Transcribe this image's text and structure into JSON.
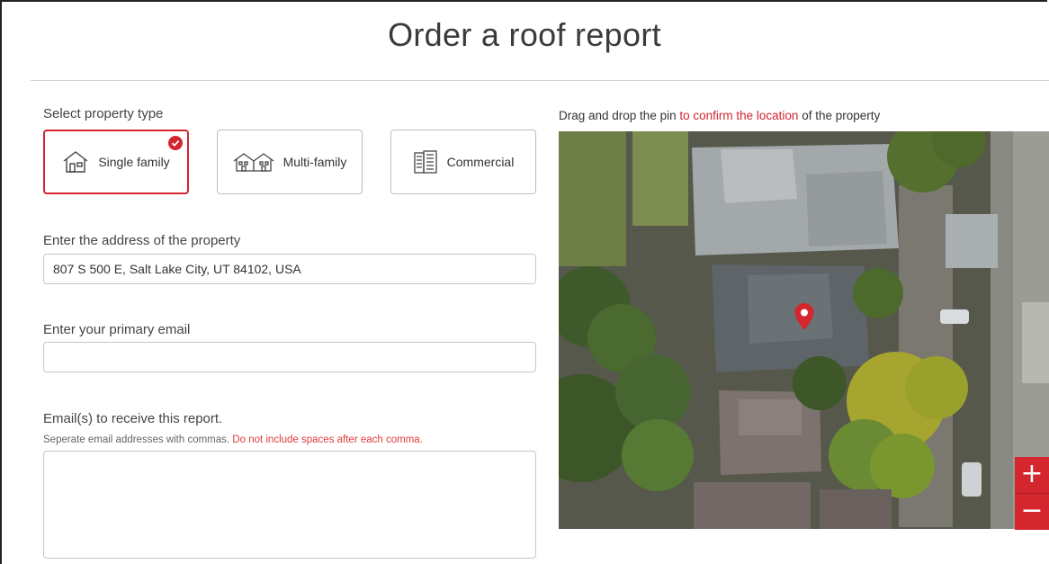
{
  "page": {
    "title": "Order a roof report"
  },
  "property_type": {
    "label": "Select property type",
    "options": [
      {
        "label": "Single family",
        "icon": "single-family-house-icon",
        "selected": true
      },
      {
        "label": "Multi-family",
        "icon": "multi-family-house-icon",
        "selected": false
      },
      {
        "label": "Commercial",
        "icon": "commercial-building-icon",
        "selected": false
      }
    ]
  },
  "address": {
    "label": "Enter the address of the property",
    "value": "807 S 500 E, Salt Lake City, UT 84102, USA"
  },
  "primary_email": {
    "label": "Enter your primary email",
    "value": ""
  },
  "report_emails": {
    "label": "Email(s) to receive this report.",
    "hint": "Seperate email addresses with commas.",
    "hint_warning": "Do not include spaces after each comma.",
    "value": ""
  },
  "map": {
    "label_prefix": "Drag and drop the pin",
    "label_highlight": "to confirm the location",
    "label_suffix": "of the property",
    "zoom_in": "+",
    "zoom_out": "−",
    "pin_icon": "map-pin-icon"
  },
  "colors": {
    "accent": "#d3262e",
    "border": "#c6c6c6",
    "text": "#333333"
  }
}
